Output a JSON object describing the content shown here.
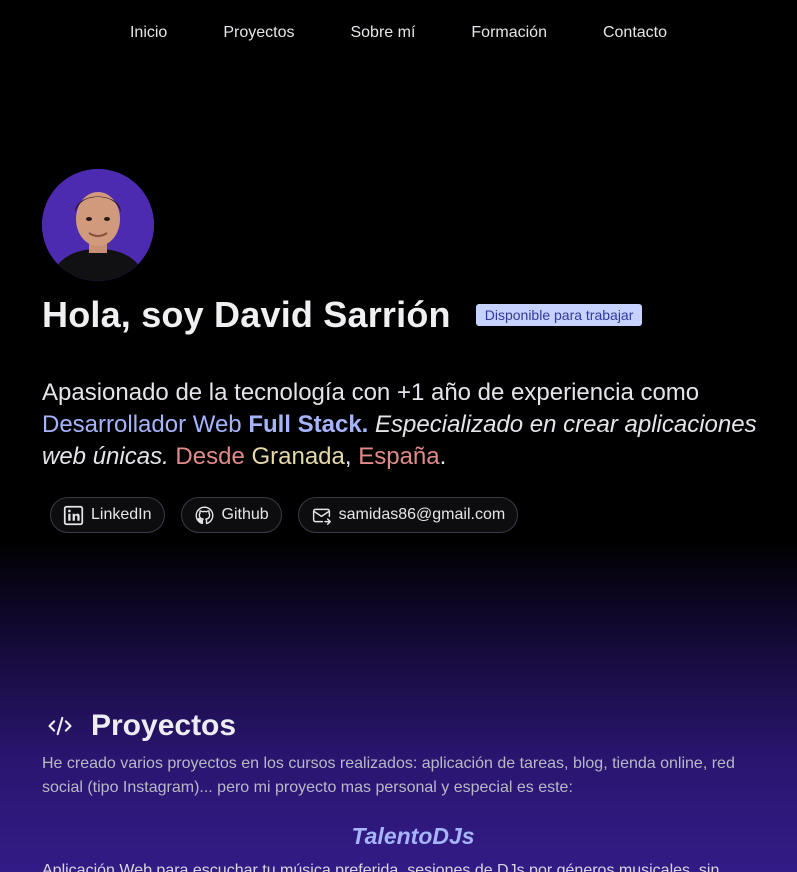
{
  "nav": {
    "items": [
      {
        "label": "Inicio"
      },
      {
        "label": "Proyectos"
      },
      {
        "label": "Sobre mí"
      },
      {
        "label": "Formación"
      },
      {
        "label": "Contacto"
      }
    ]
  },
  "hero": {
    "avatar_icon": "profile-photo",
    "title": "Hola, soy David Sarrión",
    "badge": "Disponible para trabajar",
    "bio": {
      "p1": "Apasionado de la tecnología con +1 año de experiencia como ",
      "p2": "Desarrollador Web ",
      "p3": "Full Stack.",
      "p4": " Especializado en crear aplicaciones web únicas.",
      "p5": " ",
      "p6": "Desde",
      "p7": " ",
      "p8": "Granada",
      "p9": ", ",
      "p10": "España",
      "p11": "."
    },
    "links": [
      {
        "label": "LinkedIn",
        "icon": "linkedin-icon"
      },
      {
        "label": "Github",
        "icon": "github-icon"
      },
      {
        "label": "samidas86@gmail.com",
        "icon": "mail-icon"
      }
    ]
  },
  "projects": {
    "icon": "code-icon",
    "title": "Proyectos",
    "description": "He creado varios proyectos en los cursos realizados: aplicación de tareas, blog, tienda online, red social (tipo Instagram)... pero mi proyecto mas personal y especial es este:",
    "featured_name": "TalentoDJs",
    "featured_text": "Aplicación Web para escuchar tu música preferida, sesiones de DJs por géneros musicales, sin"
  },
  "colors": {
    "accent": "#a5b4fc",
    "badge_bg": "#c7d2fe",
    "badge_text": "#2f3b9c",
    "highlight_red": "#e08a8a",
    "highlight_yellow": "#e6d9a8",
    "bg_bottom": "#331b86"
  }
}
